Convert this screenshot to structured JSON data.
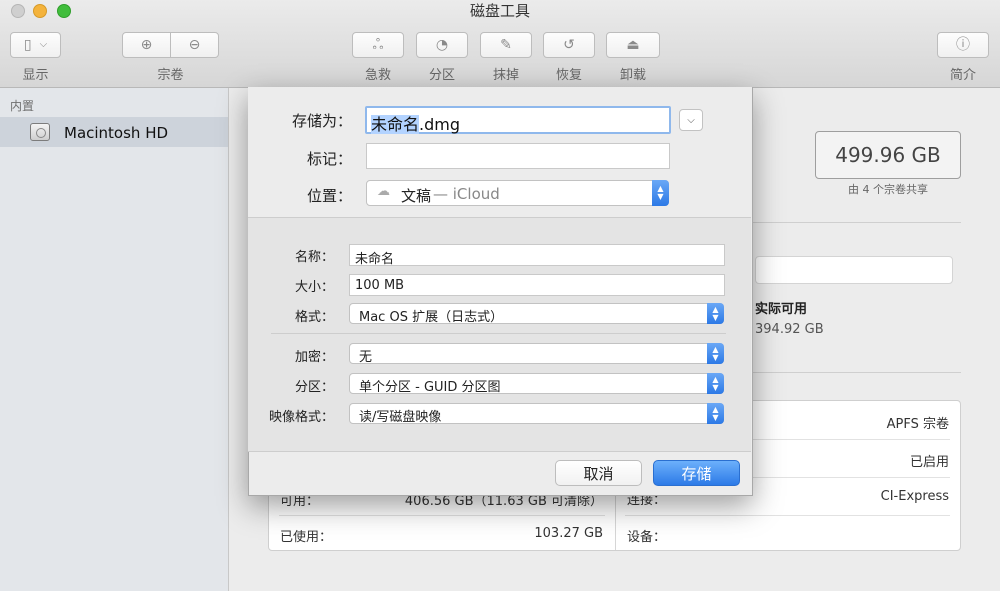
{
  "window": {
    "title": "磁盘工具"
  },
  "toolbar": {
    "view_label": "显示",
    "volume_label": "宗卷",
    "firstaid_label": "急救",
    "partition_label": "分区",
    "erase_label": "抹掉",
    "restore_label": "恢复",
    "unmount_label": "卸载",
    "info_label": "简介"
  },
  "sidebar": {
    "section": "内置",
    "items": [
      {
        "label": "Macintosh HD"
      }
    ]
  },
  "main": {
    "capacity": "499.96 GB",
    "shared": "由 4 个宗卷共享",
    "available_heading": "实际可用",
    "available_value": "394.92 GB",
    "table": {
      "left": [
        {
          "label": "可用：",
          "value": "406.56 GB（11.63 GB 可清除）"
        },
        {
          "label": "已使用：",
          "value": "103.27 GB"
        }
      ],
      "right": [
        {
          "label": "",
          "value": "APFS 宗卷"
        },
        {
          "label": "",
          "value": "已启用"
        },
        {
          "label": "连接：",
          "value": "CI-Express"
        },
        {
          "label": "设备：",
          "value": ""
        }
      ]
    }
  },
  "dialog": {
    "save_as_label": "存储为：",
    "save_as_value_selected": "未命名",
    "save_as_value_ext": ".dmg",
    "tags_label": "标记：",
    "tags_value": "",
    "where_label": "位置：",
    "where_value": "文稿",
    "where_suffix": " — iCloud",
    "name_label": "名称：",
    "name_value": "未命名",
    "size_label": "大小：",
    "size_value": "100 MB",
    "format_label": "格式：",
    "format_value": "Mac OS 扩展（日志式）",
    "encryption_label": "加密：",
    "encryption_value": "无",
    "partition_label": "分区：",
    "partition_value": "单个分区 - GUID 分区图",
    "image_format_label": "映像格式：",
    "image_format_value": "读/写磁盘映像",
    "cancel_label": "取消",
    "save_label": "存储"
  },
  "colors": {
    "accent": "#2f7be8",
    "selection": "#b3d3ff",
    "sidebar_selection": "#cdd3db"
  }
}
